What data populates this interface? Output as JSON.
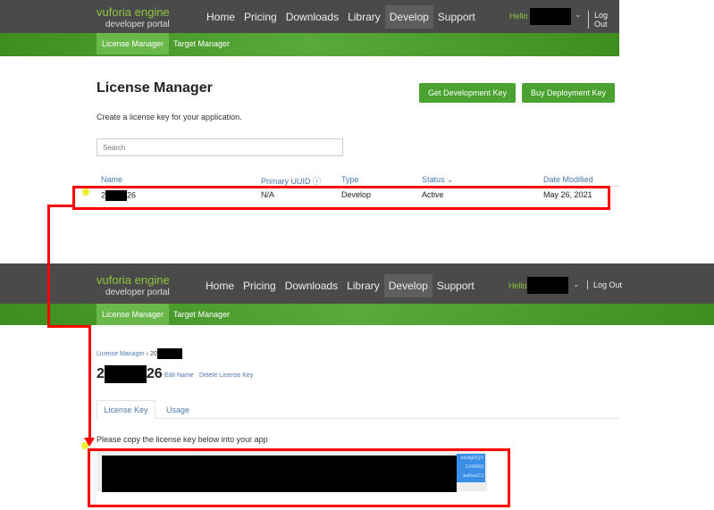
{
  "header": {
    "logo_brand": "vuforia engine",
    "logo_sub": "developer portal",
    "nav": [
      "Home",
      "Pricing",
      "Downloads",
      "Library",
      "Develop",
      "Support"
    ],
    "active_nav": "Develop",
    "hello": "Hello",
    "logout": "Log Out"
  },
  "subnav": {
    "items": [
      "License Manager",
      "Target Manager"
    ]
  },
  "list": {
    "title": "License Manager",
    "subtitle": "Create a license key for your application.",
    "search_placeholder": "Search",
    "get_dev_key": "Get Development Key",
    "buy_deploy_key": "Buy Deployment Key",
    "columns": [
      "Name",
      "Primary UUID ⓘ",
      "Type",
      "Status ⌄",
      "Date Modified"
    ],
    "row": {
      "name_prefix": "2",
      "name_suffix": "26",
      "uuid": "N/A",
      "type": "Develop",
      "status": "Active",
      "date": "May 26, 2021"
    }
  },
  "detail": {
    "breadcrumb_root": "License Manager",
    "breadcrumb_sep": "›",
    "breadcrumb_prefix": "20",
    "title_prefix": "2",
    "title_suffix": "26",
    "edit_name": "Edit Name",
    "delete_key": "Delete License Key",
    "tabs": [
      "License Key",
      "Usage"
    ],
    "instruction": "Please copy the license key below into your app",
    "key_fragments": [
      "ebdlgRQX",
      "2J/89R9",
      "kaRauCJ"
    ]
  },
  "colors": {
    "accent": "#4aa331",
    "annotation": "#ff0000"
  }
}
